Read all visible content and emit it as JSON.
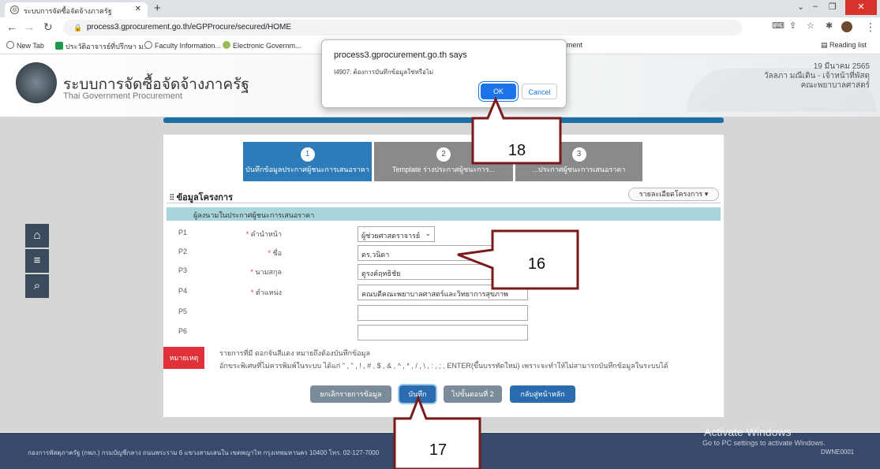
{
  "browser": {
    "tab_title": "ระบบการจัดซื้อจัดจ้างภาครัฐ",
    "url": "process3.gprocurement.go.th/eGPProcure/secured/HOME",
    "reading_list": "Reading list",
    "bookmarks": [
      "New Tab",
      "ประวัติอาจารย์ที่ปรึกษา ม...",
      "Faculty Information...",
      "Electronic Governm...",
      "ment"
    ]
  },
  "header": {
    "title_th": "ระบบการจัดซื้อจัดจ้างภาครัฐ",
    "title_en": "Thai Government Procurement",
    "date": "19 มีนาคม 2565",
    "user": "วัลลภา มณีเดิน - เจ้าหน้าที่พัสดุ",
    "org": "คณะพยาบาลศาสตร์"
  },
  "steps": [
    {
      "num": "1",
      "label": "บันทึกข้อมูลประกาศผู้ชนะการเสนอราคา"
    },
    {
      "num": "2",
      "label": "Template ร่างประกาศผู้ชนะการ..."
    },
    {
      "num": "3",
      "label": "...ประกาศผู้ชนะการเสนอราคา"
    }
  ],
  "section": {
    "title": "ข้อมูลโครงการ",
    "detail_button": "รายละเอียดโครงการ",
    "subhead": "ผู้ลงนามในประกาศผู้ชนะการเสนอราคา"
  },
  "rows": [
    {
      "code": "P1",
      "field": "คำนำหน้า",
      "required": true,
      "value": "ผู้ช่วยศาสตราจารย์"
    },
    {
      "code": "P2",
      "field": "ชื่อ",
      "required": true,
      "value": "ดร.วนิดา"
    },
    {
      "code": "P3",
      "field": "นามสกุล",
      "required": true,
      "value": "ดูรงค์ฤทธิชัย"
    },
    {
      "code": "P4",
      "field": "ตำแหน่ง",
      "required": true,
      "value": "คณบดีคณะพยาบาลศาสตร์และวิทยาการสุขภาพ"
    },
    {
      "code": "P5",
      "field": "",
      "required": false,
      "value": ""
    },
    {
      "code": "P6",
      "field": "",
      "required": false,
      "value": ""
    }
  ],
  "note": {
    "badge": "หมายเหตุ",
    "line1": "รายการที่มี ดอกจันสีแดง หมายถึงต้องบันทึกข้อมูล",
    "line2": "อักขระพิเศษที่ไม่ควรพิมพ์ในระบบ ได้แก่ \" , \" , ! , # , $ , & , ^ , * , / , \\ , : , ; , ENTER(ขึ้นบรรทัดใหม่) เพราะจะทำให้ไม่สามารถบันทึกข้อมูลในระบบได้"
  },
  "buttons": {
    "cancel": "ยกเลิกรายการข้อมูล",
    "save": "บันทึก",
    "next": "ไปขั้นตอนที่ 2",
    "home": "กลับสู่หน้าหลัก"
  },
  "footer": {
    "text": "กองการพัสดุภาครัฐ (กพภ.) กรมบัญชีกลาง ถนนพระราม 6 แขวงสามเสนใน เขตพญาไท กรุงเทพมหานคร 10400 โทร. 02-127-7000",
    "code": "DWNE0001"
  },
  "dialog": {
    "title": "process3.gprocurement.go.th says",
    "message": "I4907: ต้องการบันทึกข้อมูลใช่หรือไม่",
    "ok": "OK",
    "cancel": "Cancel"
  },
  "callouts": [
    "18",
    "16",
    "17"
  ],
  "watermark": {
    "line1": "Activate Windows",
    "line2": "Go to PC settings to activate Windows."
  },
  "colors": {
    "accent": "#1d6fa3",
    "step_active": "#2d7bb8",
    "step_inactive": "#8a8a8a",
    "callout_border": "#7a1a1a"
  }
}
